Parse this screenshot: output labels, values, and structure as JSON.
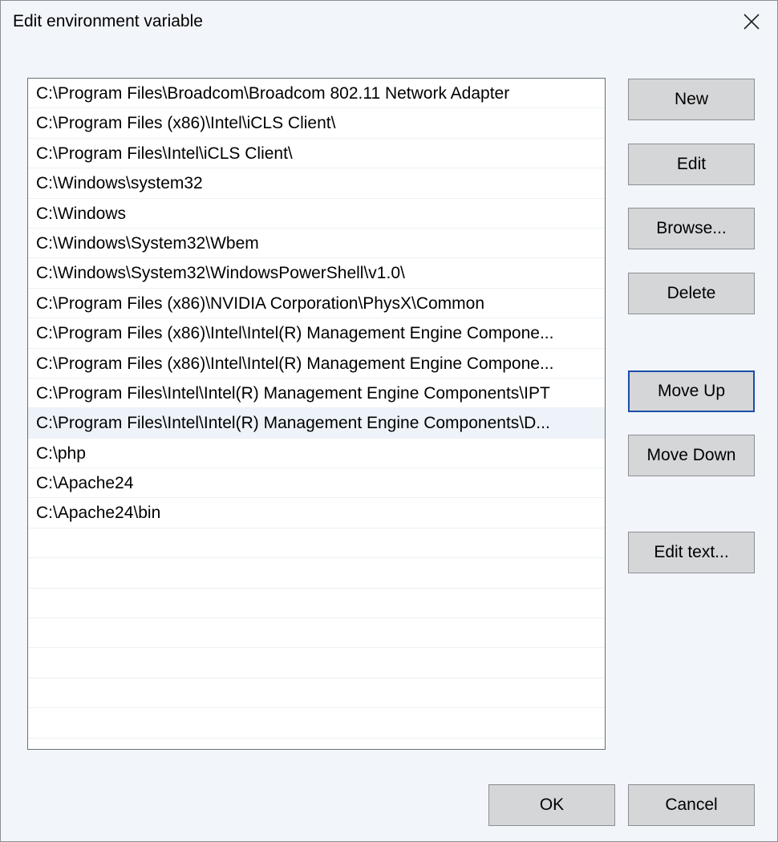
{
  "dialog": {
    "title": "Edit environment variable"
  },
  "paths": [
    "C:\\Program Files\\Broadcom\\Broadcom 802.11 Network Adapter",
    "C:\\Program Files (x86)\\Intel\\iCLS Client\\",
    "C:\\Program Files\\Intel\\iCLS Client\\",
    "C:\\Windows\\system32",
    "C:\\Windows",
    "C:\\Windows\\System32\\Wbem",
    "C:\\Windows\\System32\\WindowsPowerShell\\v1.0\\",
    "C:\\Program Files (x86)\\NVIDIA Corporation\\PhysX\\Common",
    "C:\\Program Files (x86)\\Intel\\Intel(R) Management Engine Compone...",
    "C:\\Program Files (x86)\\Intel\\Intel(R) Management Engine Compone...",
    "C:\\Program Files\\Intel\\Intel(R) Management Engine Components\\IPT",
    "C:\\Program Files\\Intel\\Intel(R) Management Engine Components\\D...",
    "C:\\php",
    "C:\\Apache24",
    "C:\\Apache24\\bin"
  ],
  "buttons": {
    "new": "New",
    "edit": "Edit",
    "browse": "Browse...",
    "delete": "Delete",
    "move_up": "Move Up",
    "move_down": "Move Down",
    "edit_text": "Edit text...",
    "ok": "OK",
    "cancel": "Cancel"
  }
}
